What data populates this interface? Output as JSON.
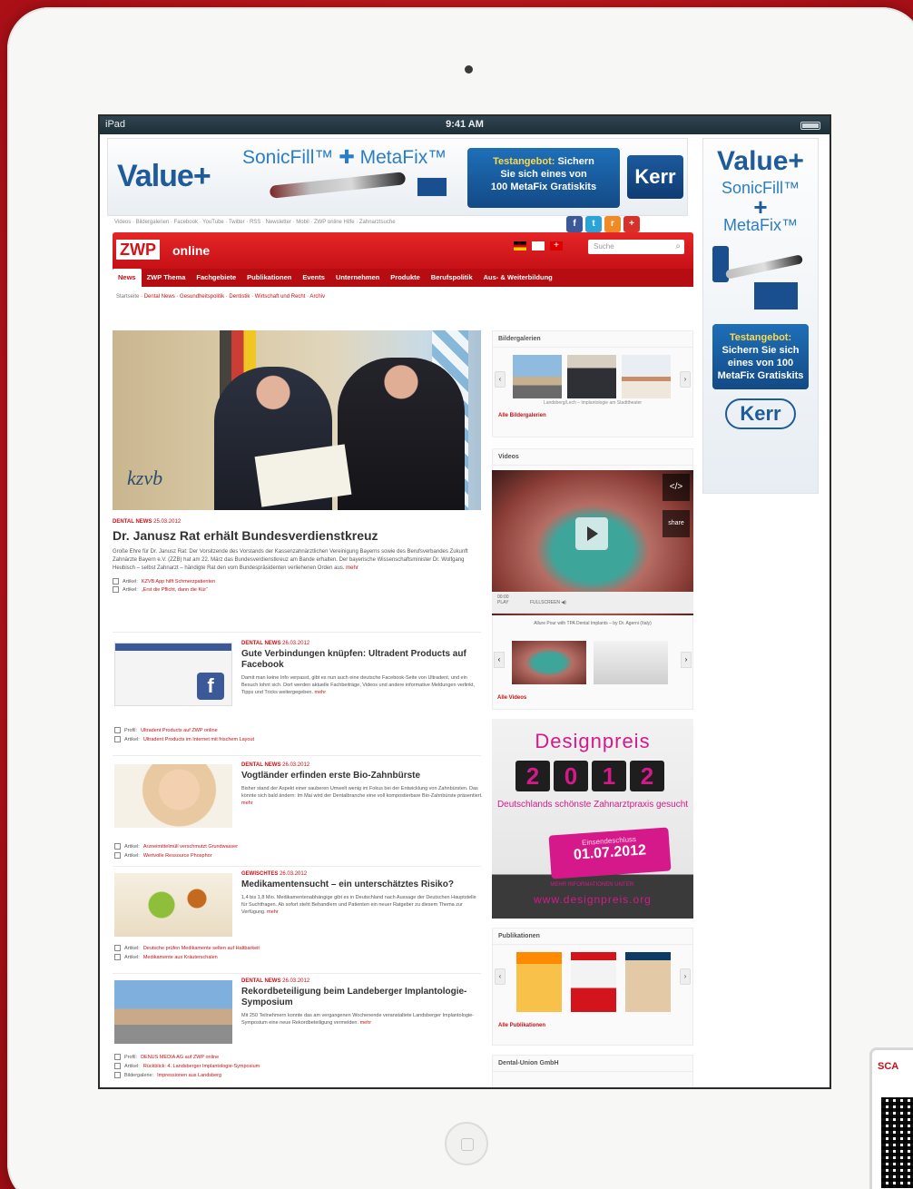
{
  "statusbar": {
    "device": "iPad",
    "time": "9:41 AM"
  },
  "top_banner": {
    "value": "Value+",
    "product": "SonicFill™ ✚ MetaFix™",
    "offer_title": "Testangebot:",
    "offer_text_1": "Sichern",
    "offer_text_2": "Sie sich eines von",
    "offer_text_3": "100 MetaFix Gratiskits",
    "brand": "Kerr"
  },
  "sky_banner": {
    "value": "Value+",
    "p1": "SonicFill™",
    "plus": "+",
    "p2": "MetaFix™",
    "offer_title": "Testangebot:",
    "offer_text": "Sichern Sie sich eines von 100 MetaFix Gratiskits",
    "brand": "Kerr"
  },
  "toplinks": "Videos · Bildergalerien · Facebook · YouTube · Twitter · RSS · Newsletter · Mobil · ZWP online Hilfe · Zahnarztsuche",
  "social": [
    "f",
    "t",
    "r",
    "+"
  ],
  "header": {
    "logo": "ZWP",
    "logo_suffix": "online",
    "search_placeholder": "Suche"
  },
  "nav": [
    "News",
    "ZWP Thema",
    "Fachgebiete",
    "Publikationen",
    "Events",
    "Unternehmen",
    "Produkte",
    "Berufspolitik",
    "Aus- & Weiterbildung"
  ],
  "breadcrumbs": {
    "home": "Startseite",
    "items": "Dental News · Gesundheitspolitik · Dentistik · Wirtschaft und Recht · Archiv"
  },
  "main_article": {
    "kicker": "DENTAL NEWS",
    "date": "25.03.2012",
    "title": "Dr. Janusz Rat erhält Bundesverdienstkreuz",
    "text": "Große Ehre für Dr. Janusz Rat: Der Vorsitzende des Vorstands der Kassenzahnärztlichen Vereinigung Bayerns sowie des Berufsverbandes Zukunft Zahnärzte Bayern e.V. (ZZB) hat am 22. März das Bundesverdienstkreuz am Bande erhalten. Der bayerische Wissenschaftsminister Dr. Wolfgang Heubisch – selbst Zahnarzt – händigte Rat den vom Bundespräsidenten verliehenen Orden aus.",
    "more": "mehr",
    "links": [
      {
        "type": "Artikel:",
        "text": "KZVB App hilft Schmerzpatienten"
      },
      {
        "type": "Artikel:",
        "text": "„Erst die Pflicht, dann die Kür“"
      }
    ],
    "image_logo": "kzvb"
  },
  "teasers": [
    {
      "kicker": "DENTAL NEWS",
      "date": "26.03.2012",
      "title": "Gute Verbindungen knüpfen: Ultradent Products auf Facebook",
      "text": "Damit man keine Info verpasst, gibt es nun auch eine deutsche Facebook-Seite von Ultradent, und ein Besuch lohnt sich. Dort werden aktuelle Fachbeiträge, Videos und andere informative Meldungen verlinkt, Tipps und Tricks weitergegeben.",
      "more": "mehr",
      "links": [
        {
          "type": "Profil:",
          "text": "Ultradent Products auf ZWP online"
        },
        {
          "type": "Artikel:",
          "text": "Ultradent Products im Internet mit frischem Layout"
        }
      ]
    },
    {
      "kicker": "DENTAL NEWS",
      "date": "26.03.2012",
      "title": "Vogtländer erfinden erste Bio-Zahnbürste",
      "text": "Bisher stand der Aspekt einer sauberen Umwelt wenig im Fokus bei der Entwicklung von Zahnbürsten. Das könnte sich bald ändern: Im Mai wird der Dentalbranche eine voll kompostierbare Bio-Zahnbürste präsentiert.",
      "more": "mehr",
      "links": [
        {
          "type": "Artikel:",
          "text": "Arzneimittelmüll verschmutzt Grundwasser"
        },
        {
          "type": "Artikel:",
          "text": "Wertvolle Ressource Phosphor"
        }
      ]
    },
    {
      "kicker": "GEWISCHTES",
      "date": "26.03.2012",
      "title": "Medikamentensucht – ein unterschätztes Risiko?",
      "text": "1,4 bis 1,8 Mio. Medikamentenabhängige gibt es in Deutschland nach Aussage der Deutschen Hauptstelle für Suchtfragen. Ab sofort steht Behandlern und Patienten ein neuer Ratgeber zu diesem Thema zur Verfügung.",
      "more": "mehr",
      "links": [
        {
          "type": "Artikel:",
          "text": "Deutsche prüfen Medikamente selten auf Haltbarkeit"
        },
        {
          "type": "Artikel:",
          "text": "Medikamente aus Kräuterschalen"
        }
      ]
    },
    {
      "kicker": "DENTAL NEWS",
      "date": "26.03.2012",
      "title": "Rekordbeteiligung beim Landeberger Implantologie-Symposium",
      "text": "Mit 250 Teilnehmern konnte das am vergangenen Wochenende veranstaltete Landsberger Implantologie-Symposium eine neue Rekordbeteiligung vermelden.",
      "more": "mehr",
      "links": [
        {
          "type": "Profil:",
          "text": "DENUS MEDIA AG auf ZWP online"
        },
        {
          "type": "Artikel:",
          "text": "Rückblick: 4. Landsberger Implantologie-Symposium"
        },
        {
          "type": "Bildergalerie:",
          "text": "Impressionen aus Landsberg"
        }
      ]
    }
  ],
  "sidebar": {
    "galleries": {
      "title": "Bildergalerien",
      "caption": "Landsberg/Lech – Implantologie am Stadttheater",
      "all": "Alle Bildergalerien"
    },
    "videos": {
      "title": "Videos",
      "embed": "</>",
      "share": "share",
      "play": "PLAY",
      "time": "00:00",
      "fullscreen": "FULLSCREEN",
      "caption": "Allure Pour with TPA Dental Implants – by Dr. Agerni (Italy)",
      "all": "Alle Videos"
    },
    "designpreis": {
      "title": "Designpreis",
      "year": [
        "2",
        "0",
        "1",
        "2"
      ],
      "sub": "Deutschlands schönste Zahnarztpraxis gesucht",
      "deadline_label": "Einsendeschluss",
      "deadline": "01.07.2012",
      "foot": "MEHR INFORMATIONEN UNTER:",
      "url": "www.designpreis.org"
    },
    "publications": {
      "title": "Publikationen",
      "all": "Alle Publikationen"
    },
    "dental_union": {
      "title": "Dental-Union GmbH"
    }
  },
  "qr": {
    "label": "SCA"
  }
}
